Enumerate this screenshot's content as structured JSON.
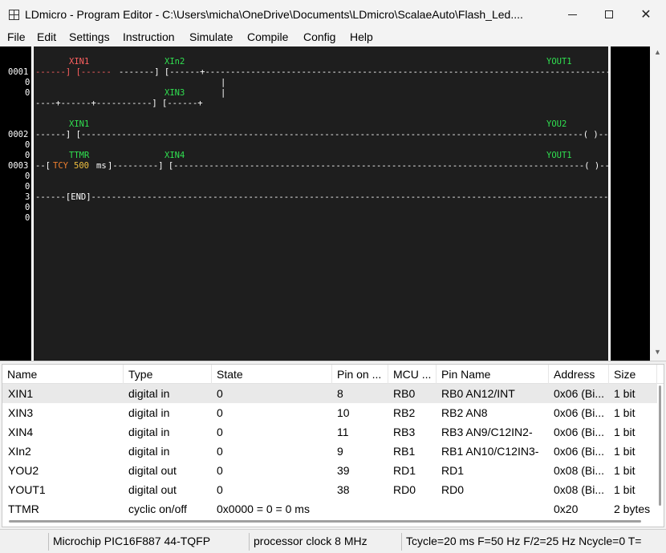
{
  "window": {
    "title": "LDmicro - Program Editor - C:\\Users\\micha\\OneDrive\\Documents\\LDmicro\\ScalaeAuto\\Flash_Led....",
    "min_glyph": "",
    "max_glyph": "",
    "close_glyph": "✕"
  },
  "menu": [
    "File",
    "Edit",
    "Settings",
    "Instruction",
    "Simulate",
    "Compile",
    "Config",
    "Help"
  ],
  "ladder": {
    "rung1": {
      "num": "0001",
      "sub1": "0",
      "sub2": "0",
      "xin1_name": "XIN1",
      "xin2_name": "XIn2",
      "xin3_name": "XIN3",
      "yout1_name": "YOUT1",
      "wire_left_red": "------] [------",
      "wire_mid": "-------] [------+---------------------------------------------------------------------------------( )-------",
      "vbar1": "|",
      "vbar2": "|",
      "branch_line": "----+------+-----------] [------+"
    },
    "rung2": {
      "num": "0002",
      "sub": "0",
      "xin1_name": "XIN1",
      "you2_name": "YOU2",
      "wire": "------] [---------------------------------------------------------------------------------------------------( )-------"
    },
    "rung3": {
      "num": "0003",
      "sub1": "0",
      "sub2": "0",
      "ttmr_name": "TTMR",
      "xin4_name": "XIN4",
      "yout1_name": "YOUT1",
      "wire_start": "--[",
      "tcy": "TCY",
      "tmr_value": "500",
      "tmr_unit": "ms",
      "wire_rest": "]---------] [---------------------------------------------------------------------------------( )-------"
    },
    "rung_end": {
      "num": "3",
      "sub1": "0",
      "sub2": "0",
      "pre_sub": "0",
      "wire": "------[END]-------------------------------------------------------------------------------------------------------------"
    },
    "rung_sub0": "0",
    "rung_sub0b": "0",
    "up_arrow": "▲",
    "down_arrow": "▼"
  },
  "io_list": {
    "columns": [
      "Name",
      "Type",
      "State",
      "Pin on ...",
      "MCU ...",
      "Pin Name",
      "Address",
      "Size"
    ],
    "rows": [
      [
        "XIN1",
        "digital in",
        "0",
        "8",
        "RB0",
        "RB0 AN12/INT",
        "0x06 (Bi...",
        "1 bit"
      ],
      [
        "XIN3",
        "digital in",
        "0",
        "10",
        "RB2",
        "RB2 AN8",
        "0x06 (Bi...",
        "1 bit"
      ],
      [
        "XIN4",
        "digital in",
        "0",
        "11",
        "RB3",
        "RB3 AN9/C12IN2-",
        "0x06 (Bi...",
        "1 bit"
      ],
      [
        "XIn2",
        "digital in",
        "0",
        "9",
        "RB1",
        "RB1 AN10/C12IN3-",
        "0x06 (Bi...",
        "1 bit"
      ],
      [
        "YOU2",
        "digital out",
        "0",
        "39",
        "RD1",
        "RD1",
        "0x08 (Bi...",
        "1 bit"
      ],
      [
        "YOUT1",
        "digital out",
        "0",
        "38",
        "RD0",
        "RD0",
        "0x08 (Bi...",
        "1 bit"
      ],
      [
        "TTMR",
        "cyclic on/off",
        "0x0000 = 0 = 0 ms",
        "",
        "",
        "",
        "0x20",
        "2 bytes"
      ]
    ]
  },
  "status": {
    "mcu": "Microchip PIC16F887 44-TQFP",
    "clock": "processor clock 8 MHz",
    "cycle": "Tcycle=20 ms F=50 Hz F/2=25 Hz Ncycle=0 T="
  },
  "colors": {
    "ladder_bg": "#1e1e1e",
    "wire": "#ffffff",
    "contact_name": "#30e050",
    "xin1_name": "#ff6060",
    "timer": "#f08030"
  }
}
